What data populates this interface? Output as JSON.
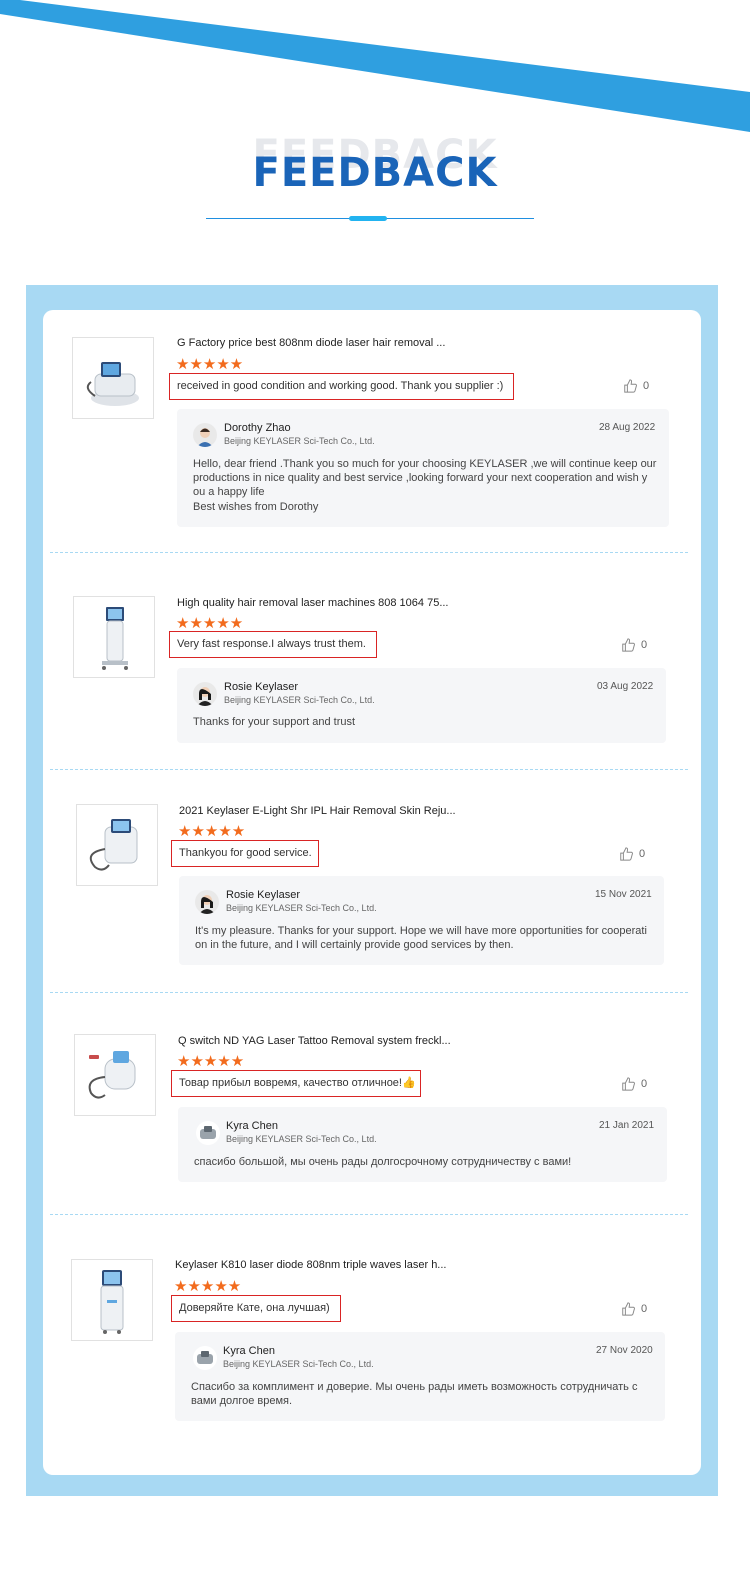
{
  "colors": {
    "accent_blue": "#1a64b8",
    "stripe_blue": "#2f9fe0",
    "frame_blue": "#a8d9f3",
    "star_orange": "#f26b1d",
    "highlight_red": "#d92424"
  },
  "heading": {
    "ghost": "FEEDBACK",
    "title": "FEEDBACK"
  },
  "reviews": [
    {
      "product_title": "G Factory price best 808nm diode laser hair removal ...",
      "stars": "★★★★★",
      "comment": "received in good condition and working good. Thank you supplier :)",
      "likes": "0",
      "reply": {
        "name": "Dorothy Zhao",
        "company": "Beijing KEYLASER Sci-Tech Co., Ltd.",
        "date": "28 Aug 2022",
        "lines": [
          "Hello, dear friend .Thank you so much for your choosing KEYLASER ,we will continue keep our",
          "productions in nice quality and best service ,looking forward your next cooperation and wish y",
          "ou a happy life",
          "Best wishes from Dorothy"
        ]
      }
    },
    {
      "product_title": "High quality hair removal laser machines 808 1064 75...",
      "stars": "★★★★★",
      "comment": "Very fast response.I always trust them.",
      "likes": "0",
      "reply": {
        "name": "Rosie Keylaser",
        "company": "Beijing KEYLASER Sci-Tech Co., Ltd.",
        "date": "03 Aug 2022",
        "lines": [
          "Thanks for your support and trust"
        ]
      }
    },
    {
      "product_title": "2021 Keylaser E-Light Shr IPL Hair Removal Skin Reju...",
      "stars": "★★★★★",
      "comment": "Thankyou for good service.",
      "likes": "0",
      "reply": {
        "name": "Rosie Keylaser",
        "company": "Beijing KEYLASER Sci-Tech Co., Ltd.",
        "date": "15 Nov 2021",
        "lines": [
          "It's my pleasure. Thanks for your support. Hope we will have more opportunities for cooperati",
          "on in the future, and I will certainly provide good services by then."
        ]
      }
    },
    {
      "product_title": "Q switch ND YAG Laser Tattoo Removal system freckl...",
      "stars": "★★★★★",
      "comment": "Товар прибыл вовремя, качество отличное!👍",
      "likes": "0",
      "reply": {
        "name": "Kyra Chen",
        "company": "Beijing KEYLASER Sci-Tech Co., Ltd.",
        "date": "21 Jan 2021",
        "lines": [
          "спасибо большой, мы очень рады долгосрочному сотрудничеству с вами!"
        ]
      }
    },
    {
      "product_title": "Keylaser K810 laser diode 808nm triple waves laser h...",
      "stars": "★★★★★",
      "comment": "Доверяйте Кате, она лучшая)",
      "likes": "0",
      "reply": {
        "name": "Kyra Chen",
        "company": "Beijing KEYLASER Sci-Tech Co., Ltd.",
        "date": "27 Nov 2020",
        "lines": [
          "Спасибо за комплимент и доверие. Мы очень рады иметь возможность сотрудничать с",
          "вами долгое время."
        ]
      }
    }
  ]
}
